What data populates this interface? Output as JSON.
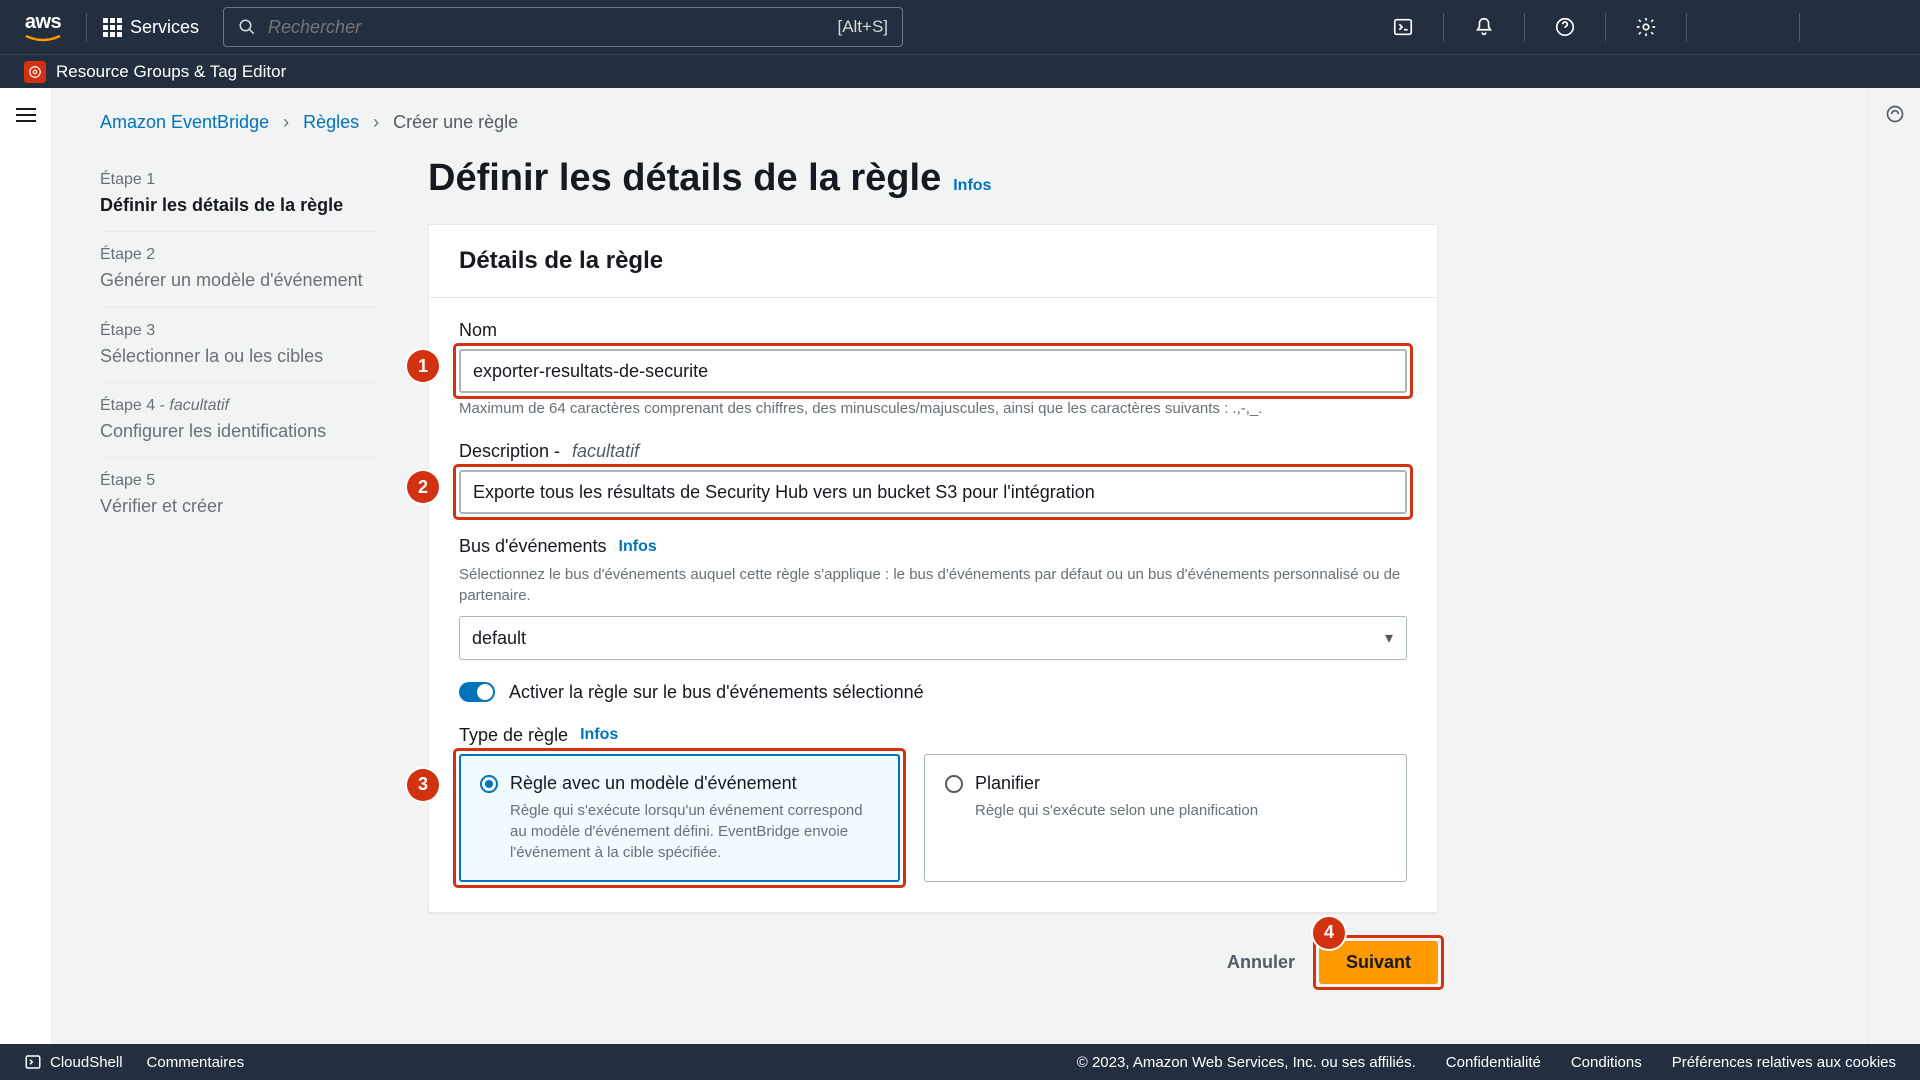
{
  "topnav": {
    "services": "Services",
    "search_placeholder": "Rechercher",
    "shortcut": "[Alt+S]"
  },
  "subnav": {
    "label": "Resource Groups & Tag Editor"
  },
  "breadcrumb": {
    "items": [
      "Amazon EventBridge",
      "Règles",
      "Créer une règle"
    ]
  },
  "steps": [
    {
      "label": "Étape 1",
      "title": "Définir les détails de la règle",
      "active": true
    },
    {
      "label": "Étape 2",
      "title": "Générer un modèle d'événement"
    },
    {
      "label": "Étape 3",
      "title": "Sélectionner la ou les cibles"
    },
    {
      "label": "Étape 4 - ",
      "optional": "facultatif",
      "title": "Configurer les identifications"
    },
    {
      "label": "Étape 5",
      "title": "Vérifier et créer"
    }
  ],
  "page": {
    "title": "Définir les détails de la règle",
    "info": "Infos",
    "card_title": "Détails de la règle"
  },
  "fields": {
    "name_label": "Nom",
    "name_value": "exporter-resultats-de-securite",
    "name_help": "Maximum de 64 caractères comprenant des chiffres, des minuscules/majuscules, ainsi que les caractères suivants : .,-,_.",
    "desc_label": "Description - ",
    "desc_optional": "facultatif",
    "desc_value": "Exporte tous les résultats de Security Hub vers un bucket S3 pour l'intégration",
    "bus_label": "Bus d'événements",
    "bus_info": "Infos",
    "bus_help": "Sélectionnez le bus d'événements auquel cette règle s'applique : le bus d'événements par défaut ou un bus d'événements personnalisé ou de partenaire.",
    "bus_value": "default",
    "toggle_label": "Activer la règle sur le bus d'événements sélectionné",
    "type_label": "Type de règle",
    "type_info": "Infos",
    "radio1_title": "Règle avec un modèle d'événement",
    "radio1_desc": "Règle qui s'exécute lorsqu'un événement correspond au modèle d'événement défini. EventBridge envoie l'événement à la cible spécifiée.",
    "radio2_title": "Planifier",
    "radio2_desc": "Règle qui s'exécute selon une planification"
  },
  "actions": {
    "cancel": "Annuler",
    "next": "Suivant"
  },
  "footer": {
    "cloudshell": "CloudShell",
    "comments": "Commentaires",
    "copyright": "© 2023, Amazon Web Services, Inc. ou ses affiliés.",
    "links": [
      "Confidentialité",
      "Conditions",
      "Préférences relatives aux cookies"
    ]
  },
  "callouts": [
    "1",
    "2",
    "3",
    "4"
  ]
}
